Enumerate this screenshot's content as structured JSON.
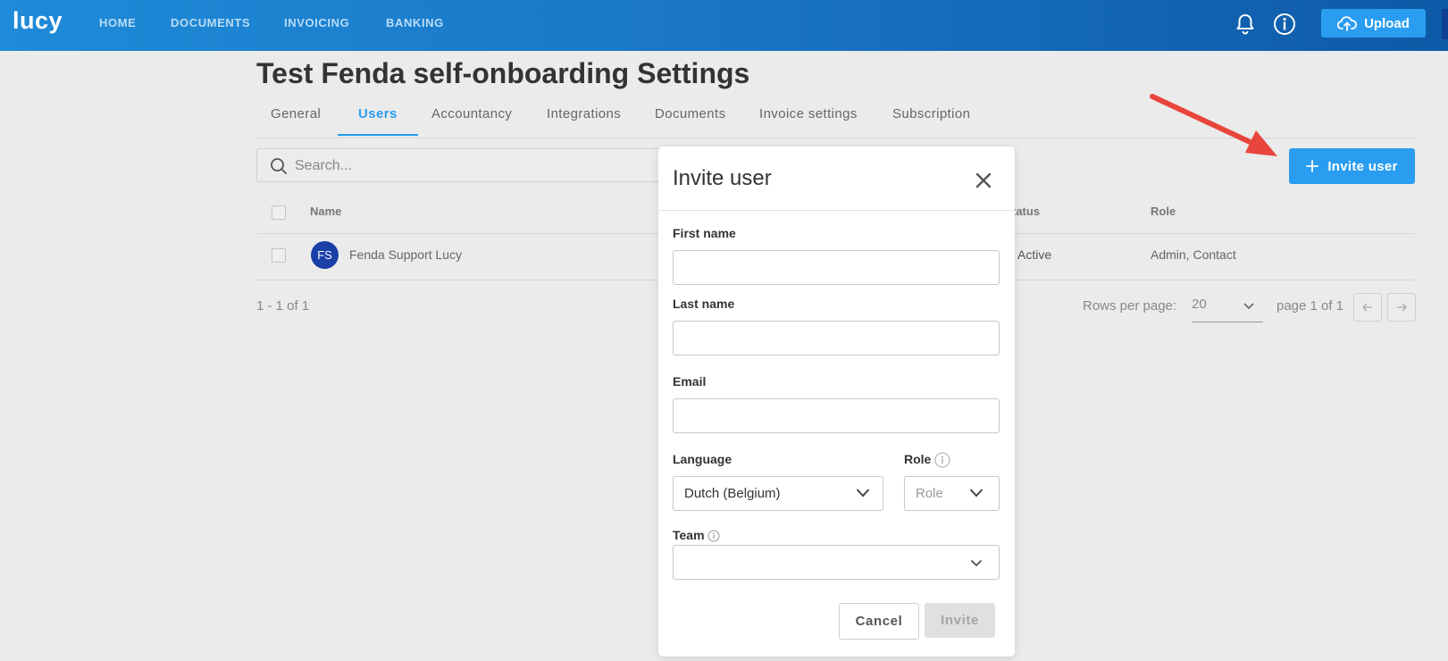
{
  "app": {
    "logo": "lucy"
  },
  "nav": {
    "items": [
      "HOME",
      "DOCUMENTS",
      "INVOICING",
      "BANKING"
    ]
  },
  "header": {
    "upload_label": "Upload"
  },
  "page": {
    "title": "Test Fenda self-onboarding Settings"
  },
  "tabs": [
    "General",
    "Users",
    "Accountancy",
    "Integrations",
    "Documents",
    "Invoice settings",
    "Subscription"
  ],
  "active_tab": "Users",
  "search": {
    "placeholder": "Search..."
  },
  "invite_button_label": "Invite user",
  "table": {
    "columns": {
      "name": "Name",
      "status": "tatus",
      "role": "Role"
    },
    "rows": [
      {
        "initials": "FS",
        "name": "Fenda Support Lucy",
        "status": "Active",
        "role": "Admin, Contact"
      }
    ]
  },
  "pagination": {
    "range": "1 - 1 of 1",
    "rows_per_page_label": "Rows per page:",
    "rows_per_page": "20",
    "page_text": "page 1 of 1"
  },
  "modal": {
    "title": "Invite user",
    "first_name_label": "First name",
    "last_name_label": "Last name",
    "email_label": "Email",
    "language_label": "Language",
    "language_value": "Dutch (Belgium)",
    "role_label": "Role",
    "role_placeholder": "Role",
    "team_label": "Team",
    "cancel_label": "Cancel",
    "invite_label": "Invite"
  },
  "colors": {
    "primary": "#2a9df0",
    "topbar": "#1a78c7",
    "avatar": "#1a3fa6",
    "arrow": "#e8453c"
  }
}
